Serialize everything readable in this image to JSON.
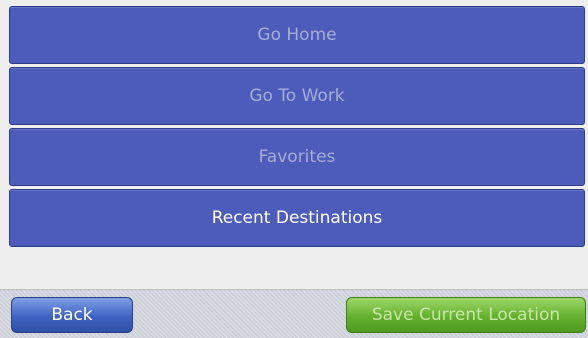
{
  "menu": {
    "items": [
      {
        "label": "Go Home"
      },
      {
        "label": "Go To Work"
      },
      {
        "label": "Favorites"
      },
      {
        "label": "Recent Destinations"
      }
    ]
  },
  "toolbar": {
    "back_label": "Back",
    "save_label": "Save Current Location"
  }
}
